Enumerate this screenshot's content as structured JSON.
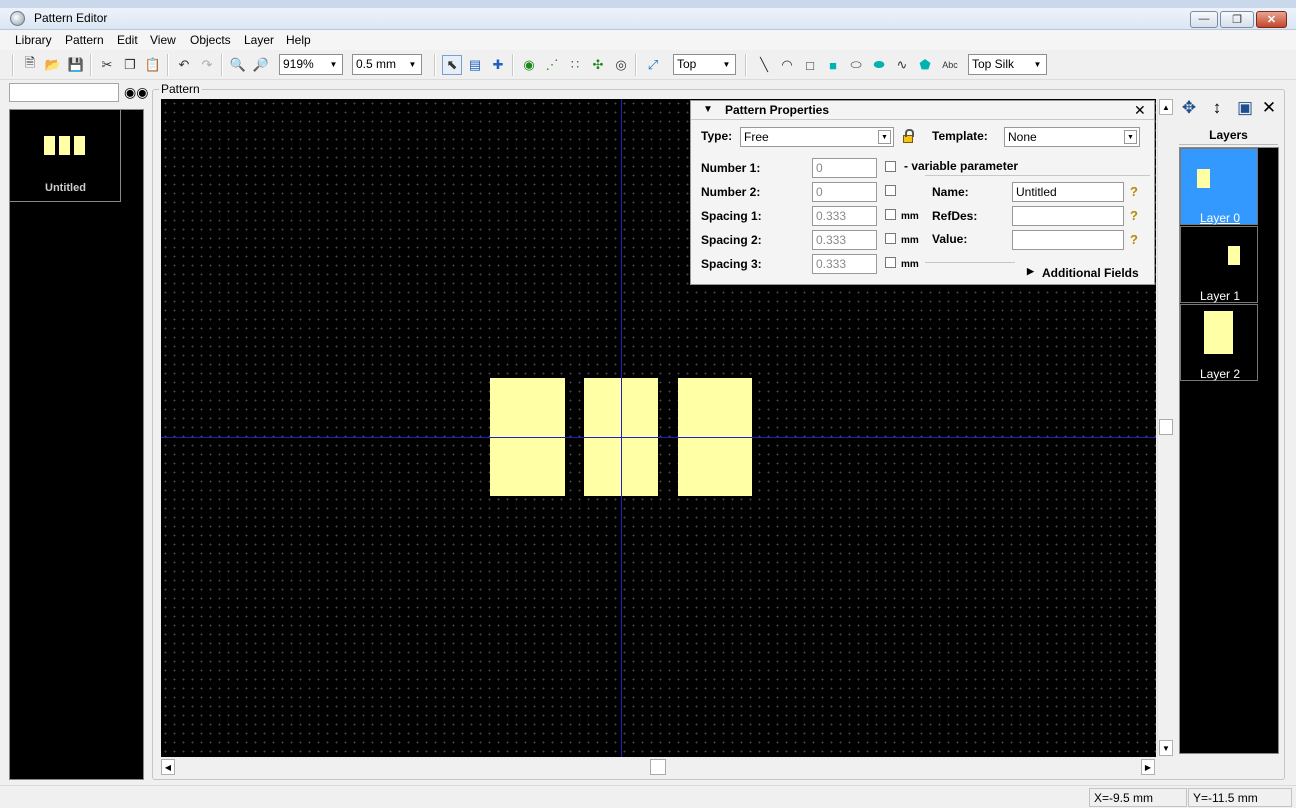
{
  "window": {
    "title": "Pattern Editor"
  },
  "menu": [
    "Library",
    "Pattern",
    "Edit",
    "View",
    "Objects",
    "Layer",
    "Help"
  ],
  "toolbar": {
    "zoom": "919%",
    "grid": "0.5 mm",
    "side": "Top",
    "text_tool": "Abc",
    "layer": "Top Silk"
  },
  "library": {
    "items": [
      {
        "name": "Untitled"
      }
    ]
  },
  "pattern_frame": {
    "label": "Pattern"
  },
  "properties": {
    "title": "Pattern Properties",
    "type_label": "Type:",
    "type_value": "Free",
    "template_label": "Template:",
    "template_value": "None",
    "number1_label": "Number 1:",
    "number1_value": "0",
    "number2_label": "Number 2:",
    "number2_value": "0",
    "variable_label": "- variable parameter",
    "spacing1_label": "Spacing 1:",
    "spacing1_value": "0.333",
    "spacing2_label": "Spacing 2:",
    "spacing2_value": "0.333",
    "spacing3_label": "Spacing 3:",
    "spacing3_value": "0.333",
    "unit": "mm",
    "name_label": "Name:",
    "name_value": "Untitled",
    "refdes_label": "RefDes:",
    "refdes_value": "",
    "value_label": "Value:",
    "value_value": "",
    "additional_fields": "Additional Fields"
  },
  "layers": {
    "title": "Layers",
    "items": [
      {
        "name": "Layer 0",
        "active": true
      },
      {
        "name": "Layer 1",
        "active": false
      },
      {
        "name": "Layer 2",
        "active": false
      }
    ]
  },
  "status": {
    "x": "X=-9.5 mm",
    "y": "Y=-11.5 mm"
  },
  "colors": {
    "pad": "#ffffa6",
    "canvas": "#000000",
    "axis": "#2020c8",
    "active_layer": "#3399ff"
  }
}
